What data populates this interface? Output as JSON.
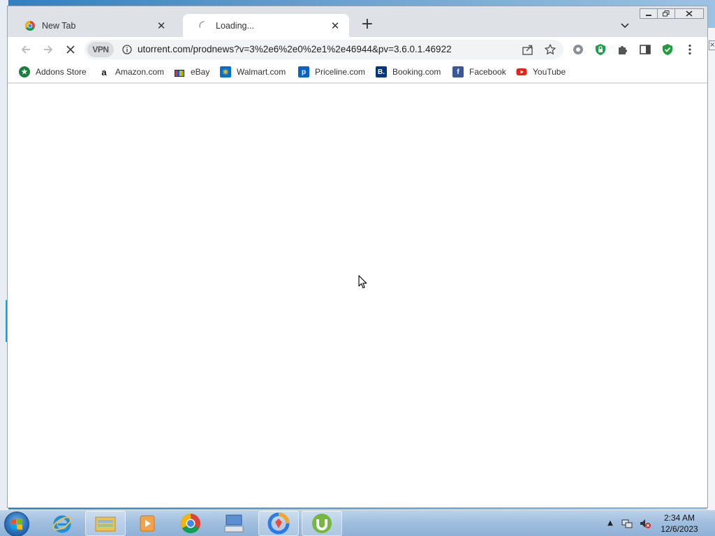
{
  "browser": {
    "tabs": [
      {
        "title": "New Tab",
        "close": "✕"
      },
      {
        "title": "Loading...",
        "close": "✕"
      }
    ],
    "new_tab": "+",
    "omnibox": {
      "vpn_label": "VPN",
      "url": "utorrent.com/prodnews?v=3%2e6%2e0%2e1%2e46944&pv=3.6.0.1.46922"
    },
    "bookmarks": [
      {
        "label": "Addons Store",
        "icon": "addons-store-icon",
        "color": "#1a7f3c"
      },
      {
        "label": "Amazon.com",
        "icon": "amazon-icon",
        "color": "#ffffff"
      },
      {
        "label": "eBay",
        "icon": "ebay-icon",
        "color": "#f2f2f2"
      },
      {
        "label": "Walmart.com",
        "icon": "walmart-icon",
        "color": "#0071ce"
      },
      {
        "label": "Priceline.com",
        "icon": "priceline-icon",
        "color": "#0a62c4"
      },
      {
        "label": "Booking.com",
        "icon": "booking-icon",
        "color": "#003580"
      },
      {
        "label": "Facebook",
        "icon": "facebook-icon",
        "color": "#3b5998"
      },
      {
        "label": "YouTube",
        "icon": "youtube-icon",
        "color": "#e62117"
      }
    ]
  },
  "taskbar": {
    "clock_time": "2:34 AM",
    "clock_date": "12/6/2023",
    "apps": [
      "internet-explorer",
      "file-explorer",
      "media-player",
      "chrome",
      "keyboard-settings",
      "ccleaner-browser",
      "utorrent"
    ]
  }
}
